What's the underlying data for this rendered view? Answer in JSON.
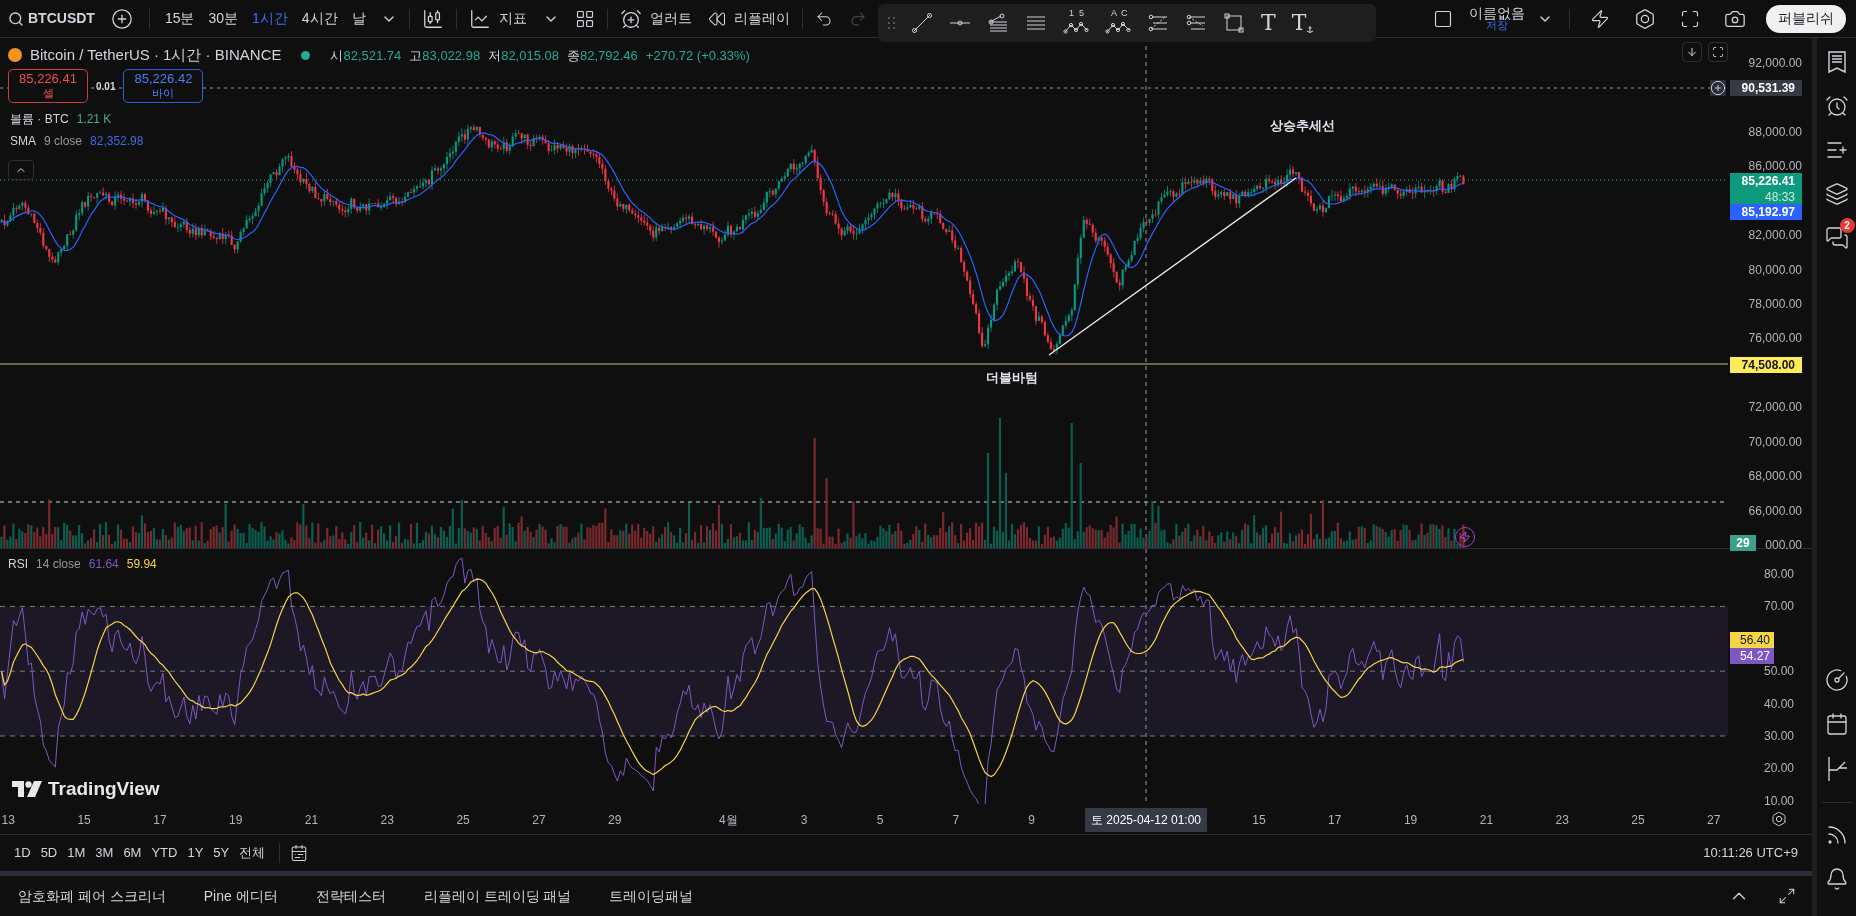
{
  "toolbar": {
    "symbol": "BTCUSDT",
    "intervals": [
      {
        "label": "15분",
        "selected": false
      },
      {
        "label": "30분",
        "selected": false
      },
      {
        "label": "1시간",
        "selected": true
      },
      {
        "label": "4시간",
        "selected": false
      },
      {
        "label": "날",
        "selected": false
      }
    ],
    "indicators_label": "지표",
    "alert_label": "얼러트",
    "replay_label": "리플레이"
  },
  "drawing_tools": [
    {
      "kind": "trend-line"
    },
    {
      "kind": "horizontal-ray"
    },
    {
      "kind": "pitchfork"
    },
    {
      "kind": "parallel-lines"
    },
    {
      "kind": "wave",
      "marks": [
        "1",
        "5"
      ]
    },
    {
      "kind": "wave",
      "marks": [
        "A",
        "C"
      ]
    },
    {
      "kind": "fib-retracement"
    },
    {
      "kind": "fib-extension"
    },
    {
      "kind": "rectangle"
    },
    {
      "kind": "text",
      "glyph": "T"
    },
    {
      "kind": "anchored-text",
      "glyph": "T"
    }
  ],
  "layout": {
    "name": "이름없음",
    "save": "저장",
    "publish": "퍼블리쉬"
  },
  "legend": {
    "title": "Bitcoin / TetherUS · 1시간 · BINANCE",
    "ohlc": [
      {
        "label": "시",
        "value": "82,521.74"
      },
      {
        "label": "고",
        "value": "83,022.98"
      },
      {
        "label": "저",
        "value": "82,015.08"
      },
      {
        "label": "종",
        "value": "82,792.46"
      }
    ],
    "change": "+270.72 (+0.33%)"
  },
  "trade": {
    "sell_price": "85,226.41",
    "sell_label": "셀",
    "spread": "0.01",
    "buy_price": "85,226.42",
    "buy_label": "바이"
  },
  "indicators": [
    {
      "name": "볼륨 · BTC",
      "value": "1.21 K",
      "color": "#4fa88b"
    },
    {
      "name": "SMA",
      "params": "9 close",
      "value": "82,352.98",
      "color": "#3f6ae0"
    }
  ],
  "annotations": [
    "상승추세선",
    "더블바텀"
  ],
  "price_axis": {
    "ticks": [
      "92,000.00",
      "88,000.00",
      "86,000.00",
      "82,000.00",
      "80,000.00",
      "78,000.00",
      "76,000.00",
      "72,000.00",
      "70,000.00",
      "68,000.00",
      "66,000.00",
      "000.00"
    ],
    "badges": [
      {
        "kind": "alert",
        "value": "90,531.39",
        "color": "#363a45"
      },
      {
        "kind": "last",
        "value": "85,226.41",
        "countdown": "48:33",
        "color": "#0f9a7e"
      },
      {
        "kind": "sma",
        "value": "85,192.97",
        "color": "#2962ff"
      },
      {
        "kind": "line",
        "value": "74,508.00",
        "color": "#ffeb5a"
      },
      {
        "kind": "volume",
        "value": "29",
        "color": "#3e9e8a"
      }
    ]
  },
  "rsi": {
    "name": "RSI",
    "params": "14 close",
    "values": [
      {
        "text": "61.64",
        "color": "#7e57c2"
      },
      {
        "text": "59.94",
        "color": "#f5d547"
      }
    ],
    "ticks": [
      "80.00",
      "70.00",
      "50.00",
      "40.00",
      "30.00",
      "20.00",
      "10.00"
    ],
    "badges": [
      {
        "value": "56.40",
        "color": "#f5d547"
      },
      {
        "value": "54.27",
        "color": "#7e57c2"
      }
    ]
  },
  "logo": "TradingView",
  "time_axis": {
    "ticks": [
      "13",
      "15",
      "17",
      "19",
      "21",
      "23",
      "25",
      "27",
      "29",
      "4월",
      "3",
      "5",
      "7",
      "9",
      "15",
      "17",
      "19",
      "21",
      "23",
      "25",
      "27"
    ],
    "crosshair": {
      "date": "토 2025-04-12",
      "time": "01:00"
    }
  },
  "ranges": [
    "1D",
    "5D",
    "1M",
    "3M",
    "6M",
    "YTD",
    "1Y",
    "5Y",
    "전체"
  ],
  "clock": "10:11:26 UTC+9",
  "bottom_tabs": [
    "암호화폐 페어 스크리너",
    "Pine 에디터",
    "전략테스터",
    "리플레이 트레이딩 패널",
    "트레이딩패널"
  ],
  "sidebar": {
    "chat_badge": "2"
  }
}
